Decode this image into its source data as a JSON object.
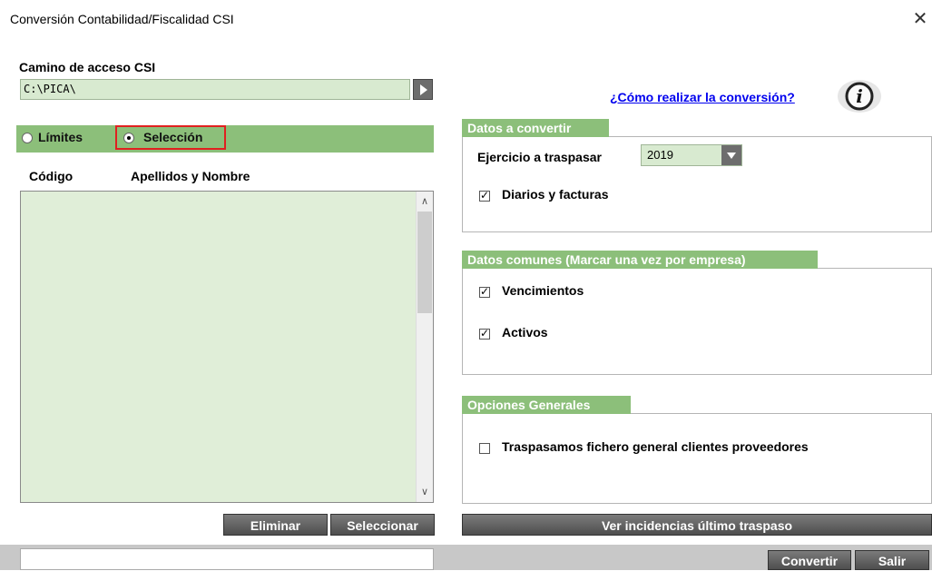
{
  "window": {
    "title": "Conversión Contabilidad/Fiscalidad CSI"
  },
  "path": {
    "label": "Camino de acceso CSI",
    "value": "C:\\PICA\\"
  },
  "help": {
    "link": "¿Cómo realizar la conversión?"
  },
  "radio": {
    "limits": "Límites",
    "selection": "Selección"
  },
  "list": {
    "col_code": "Código",
    "col_name": "Apellidos y Nombre"
  },
  "buttons": {
    "eliminar": "Eliminar",
    "seleccionar": "Seleccionar",
    "incidencias": "Ver incidencias último traspaso",
    "convertir": "Convertir",
    "salir": "Salir"
  },
  "datos_convertir": {
    "title": "Datos a convertir",
    "ejercicio_label": "Ejercicio a traspasar",
    "ejercicio_value": "2019",
    "diarios": "Diarios y facturas"
  },
  "datos_comunes": {
    "title": "Datos comunes (Marcar una vez por empresa)",
    "vencimientos": "Vencimientos",
    "activos": "Activos"
  },
  "opciones": {
    "title": "Opciones Generales",
    "traspasamos": "Traspasamos fichero general clientes proveedores"
  },
  "colors": {
    "accent_green": "#8cbf7a",
    "field_green": "#d8ead0"
  }
}
